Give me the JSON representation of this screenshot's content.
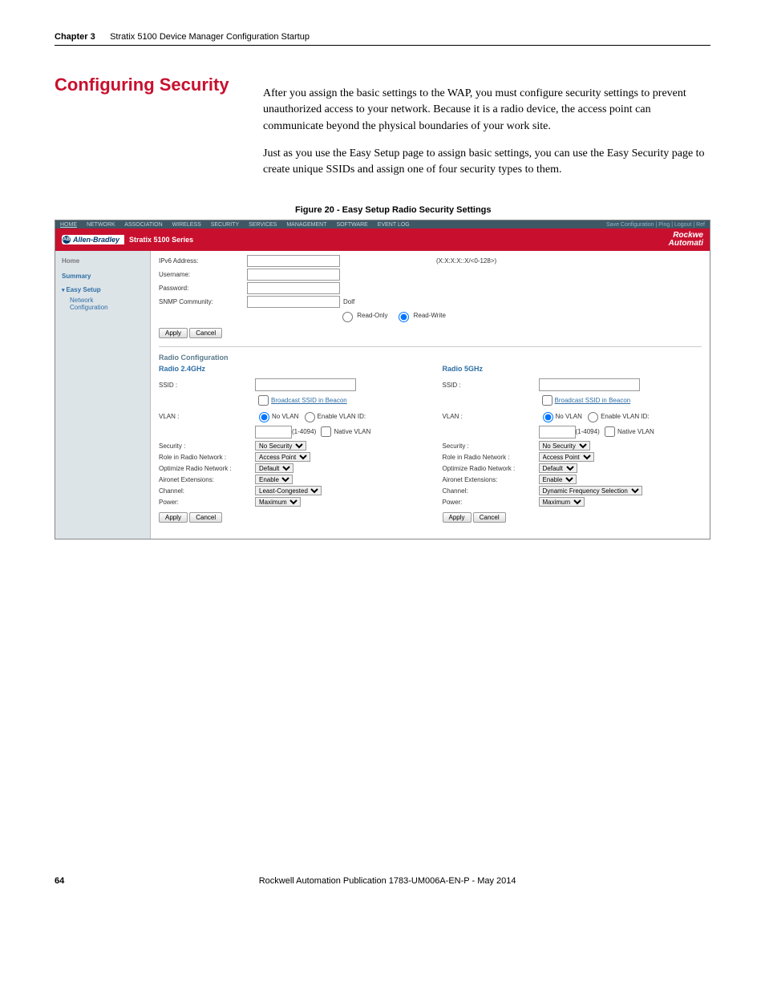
{
  "runningHead": {
    "chapter": "Chapter 3",
    "title": "Stratix 5100 Device Manager Configuration Startup"
  },
  "heading": "Configuring Security",
  "para1": "After you assign the basic settings to the WAP, you must configure security settings to prevent unauthorized access to your network. Because it is a radio device, the access point can communicate beyond the physical boundaries of your work site.",
  "para2": "Just as you use the Easy Setup page to assign basic settings, you can use the Easy Security page to create unique SSIDs and assign one of four security types to them.",
  "figCaption": "Figure 20 - Easy Setup Radio Security Settings",
  "ss": {
    "nav": [
      "HOME",
      "NETWORK",
      "ASSOCIATION",
      "WIRELESS",
      "SECURITY",
      "SERVICES",
      "MANAGEMENT",
      "SOFTWARE",
      "EVENT LOG"
    ],
    "rightLinks": "Save Configuration  |  Ping  |  Logout  |  Ref",
    "logo": "Allen-Bradley",
    "titleBar": "Stratix 5100 Series",
    "rockwell1": "Rockwe",
    "rockwell2": "Automati",
    "side": {
      "home": "Home",
      "summary": "Summary",
      "easy": "Easy Setup",
      "sub1": "Network",
      "sub2": "Configuration"
    },
    "fields": {
      "ipv6": "IPv6 Address:",
      "ipv6hint": "(X:X:X:X::X/<0-128>)",
      "username": "Username:",
      "password": "Password:",
      "snmp": "SNMP Community:",
      "snmpHint": "Dolf",
      "readOnly": "Read-Only",
      "readWrite": "Read-Write",
      "apply": "Apply",
      "cancel": "Cancel"
    },
    "radioHead": "Radio Configuration",
    "radio24": {
      "head": "Radio 2.4GHz",
      "ssid": "SSID :",
      "broadcast": "Broadcast SSID in Beacon",
      "vlan": "VLAN :",
      "noVlan": "No VLAN",
      "enableVlan": "Enable VLAN ID:",
      "vlanHint": "(1-4094)",
      "nativeVlan": "Native VLAN",
      "security": "Security :",
      "securitySel": "No Security",
      "role": "Role in Radio Network :",
      "roleSel": "Access Point",
      "optimize": "Optimize Radio Network :",
      "optimizeSel": "Default",
      "aironet": "Aironet Extensions:",
      "aironetSel": "Enable",
      "channel": "Channel:",
      "channelSel": "Least-Congested",
      "power": "Power:",
      "powerSel": "Maximum"
    },
    "radio5": {
      "head": "Radio 5GHz",
      "ssid": "SSID :",
      "broadcast": "Broadcast SSID in Beacon",
      "vlan": "VLAN :",
      "noVlan": "No VLAN",
      "enableVlan": "Enable VLAN ID:",
      "vlanHint": "(1-4094)",
      "nativeVlan": "Native VLAN",
      "security": "Security :",
      "securitySel": "No Security",
      "role": "Role in Radio Network :",
      "roleSel": "Access Point",
      "optimize": "Optimize Radio Network :",
      "optimizeSel": "Default",
      "aironet": "Aironet Extensions:",
      "aironetSel": "Enable",
      "channel": "Channel:",
      "channelSel": "Dynamic Frequency Selection",
      "power": "Power:",
      "powerSel": "Maximum"
    }
  },
  "footer": {
    "page": "64",
    "pub": "Rockwell Automation Publication 1783-UM006A-EN-P - May 2014"
  }
}
